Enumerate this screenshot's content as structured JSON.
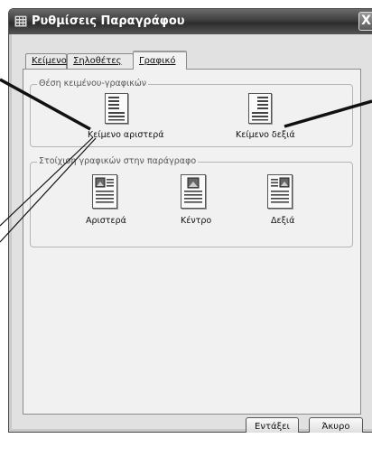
{
  "window": {
    "title": "Ρυθμίσεις Παραγράφου",
    "close_glyph": "X"
  },
  "tabs": [
    {
      "label": "Κείμενο",
      "active": false
    },
    {
      "label": "Σηλοθέτες",
      "active": false
    },
    {
      "label": "Γραφικό",
      "active": true
    }
  ],
  "text_position_group": {
    "title": "Θέση κειμένου-γραφικών",
    "options": [
      {
        "label": "Κείμενο αριστερά",
        "icon": "text-left-layout-icon"
      },
      {
        "label": "Κείμενο δεξιά",
        "icon": "text-right-layout-icon"
      }
    ]
  },
  "graphic_alignment_group": {
    "title": "Στοίχιση γραφικών στην παράγραφο",
    "options": [
      {
        "label": "Αριστερά",
        "icon": "image-align-left-icon"
      },
      {
        "label": "Κέντρο",
        "icon": "image-align-center-icon"
      },
      {
        "label": "Δεξιά",
        "icon": "image-align-right-icon"
      }
    ]
  },
  "buttons": {
    "ok_label": "Εντάξει",
    "cancel_label": "Άκυρο"
  }
}
